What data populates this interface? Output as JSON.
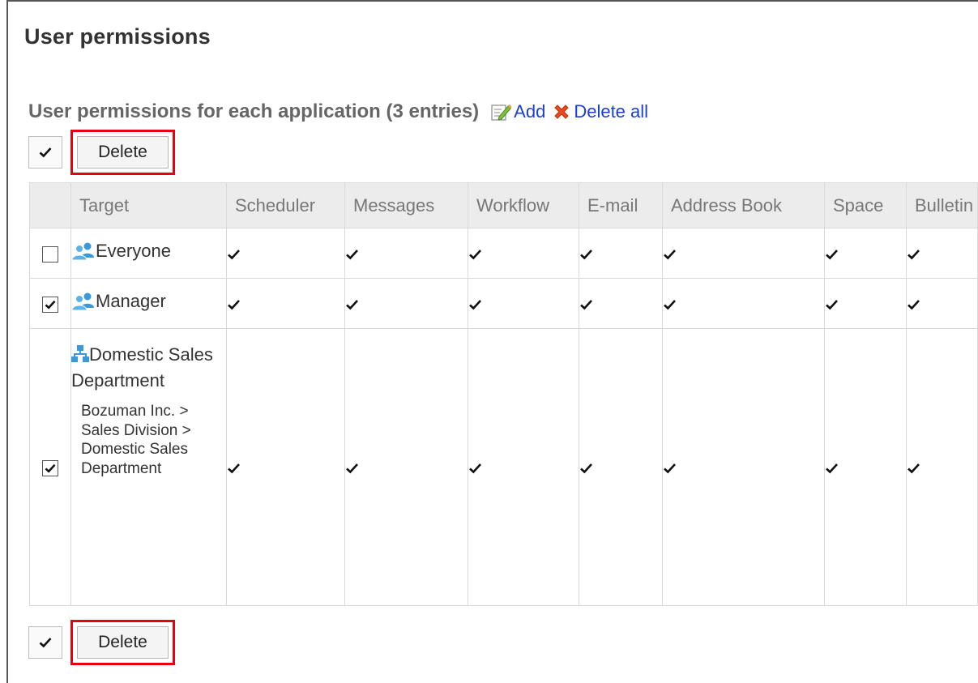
{
  "page": {
    "title": "User permissions"
  },
  "section": {
    "title": "User permissions for each application (3 entries)",
    "add_label": "Add",
    "delete_all_label": "Delete all"
  },
  "toolbar": {
    "delete_label": "Delete"
  },
  "table": {
    "columns": [
      "Target",
      "Scheduler",
      "Messages",
      "Workflow",
      "E-mail",
      "Address Book",
      "Space",
      "Bulletin"
    ],
    "rows": [
      {
        "type": "group",
        "name": "Everyone",
        "checked": false,
        "permissions": [
          true,
          true,
          true,
          true,
          true,
          true,
          true
        ]
      },
      {
        "type": "group",
        "name": "Manager",
        "checked": true,
        "permissions": [
          true,
          true,
          true,
          true,
          true,
          true,
          true
        ]
      },
      {
        "type": "organization",
        "name": "Domestic Sales Department",
        "path": "Bozuman Inc. > Sales Division > Domestic Sales Department",
        "checked": true,
        "permissions": [
          true,
          true,
          true,
          true,
          true,
          true,
          true
        ]
      }
    ]
  },
  "colors": {
    "highlight": "#e60012",
    "link": "#1a3fd6",
    "header_bg": "#ececec",
    "icon_blue": "#3a9ad9"
  },
  "icons": {
    "add": "edit-icon",
    "delete_all": "red-x-icon",
    "group": "users-group-icon",
    "organization": "org-chart-icon"
  }
}
